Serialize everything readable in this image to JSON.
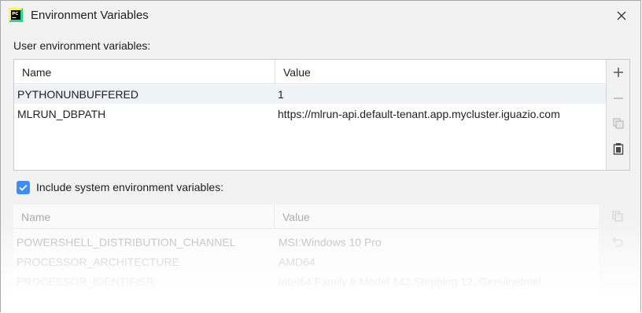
{
  "window": {
    "title": "Environment Variables",
    "app_icon_text": "PC"
  },
  "user_section": {
    "label": "User environment variables:",
    "columns": [
      "Name",
      "Value"
    ],
    "rows": [
      {
        "name": "PYTHONUNBUFFERED",
        "value": "1",
        "selected": true
      },
      {
        "name": "MLRUN_DBPATH",
        "value": "https://mlrun-api.default-tenant.app.mycluster.iguazio.com",
        "selected": false
      }
    ],
    "toolbar": [
      "add-icon",
      "remove-icon",
      "copy-icon",
      "paste-icon"
    ]
  },
  "system_section": {
    "checkbox_label": "Include system environment variables:",
    "checked": true,
    "columns": [
      "Name",
      "Value"
    ],
    "rows": [
      {
        "name": "POWERSHELL_DISTRIBUTION_CHANNEL",
        "value": "MSI:Windows 10 Pro"
      },
      {
        "name": "PROCESSOR_ARCHITECTURE",
        "value": "AMD64"
      },
      {
        "name": "PROCESSOR_IDENTIFIER",
        "value": "Intel64 Family 6 Model 142 Stepping 12, GenuineIntel"
      }
    ],
    "toolbar": [
      "copy-icon",
      "undo-icon"
    ]
  },
  "colors": {
    "accent": "#3d8df5",
    "selected_row": "#eef3fa",
    "dialog_bg": "#f2f2f2"
  }
}
